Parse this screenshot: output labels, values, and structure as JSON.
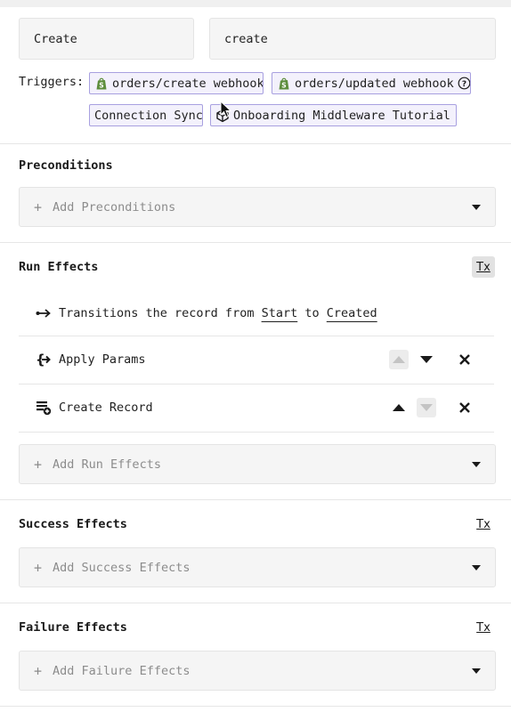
{
  "names": {
    "left_value": "Create",
    "right_value": "create"
  },
  "triggers": {
    "label": "Triggers:",
    "items": [
      {
        "label": "orders/create webhook",
        "icon": "shopify-icon"
      },
      {
        "label": "orders/updated webhook",
        "icon": "shopify-icon",
        "trailing_icon": "help-circle-icon"
      },
      {
        "label": "Connection Sync"
      },
      {
        "label": "Onboarding Middleware Tutorial …",
        "icon": "cube-icon"
      }
    ]
  },
  "preconditions": {
    "title": "Preconditions",
    "add_label": "Add Preconditions"
  },
  "run_effects": {
    "title": "Run Effects",
    "clear_label": "Tx",
    "transition": {
      "prefix": "Transitions the record from",
      "from": "Start",
      "middle": "to",
      "to": "Created"
    },
    "items": [
      {
        "label": "Apply Params",
        "icon": "apply-params-icon",
        "up_enabled": false,
        "down_enabled": true
      },
      {
        "label": "Create Record",
        "icon": "create-record-icon",
        "up_enabled": true,
        "down_enabled": false
      }
    ],
    "add_label": "Add Run Effects"
  },
  "success_effects": {
    "title": "Success Effects",
    "clear_label": "Tx",
    "add_label": "Add Success Effects"
  },
  "failure_effects": {
    "title": "Failure Effects",
    "clear_label": "Tx",
    "add_label": "Add Failure Effects"
  },
  "colors": {
    "trigger_border": "#a8a0e0",
    "trigger_bg": "#f3f1fc",
    "shopify_green": "#5e8e3e",
    "field_bg": "#f5f5f5"
  }
}
